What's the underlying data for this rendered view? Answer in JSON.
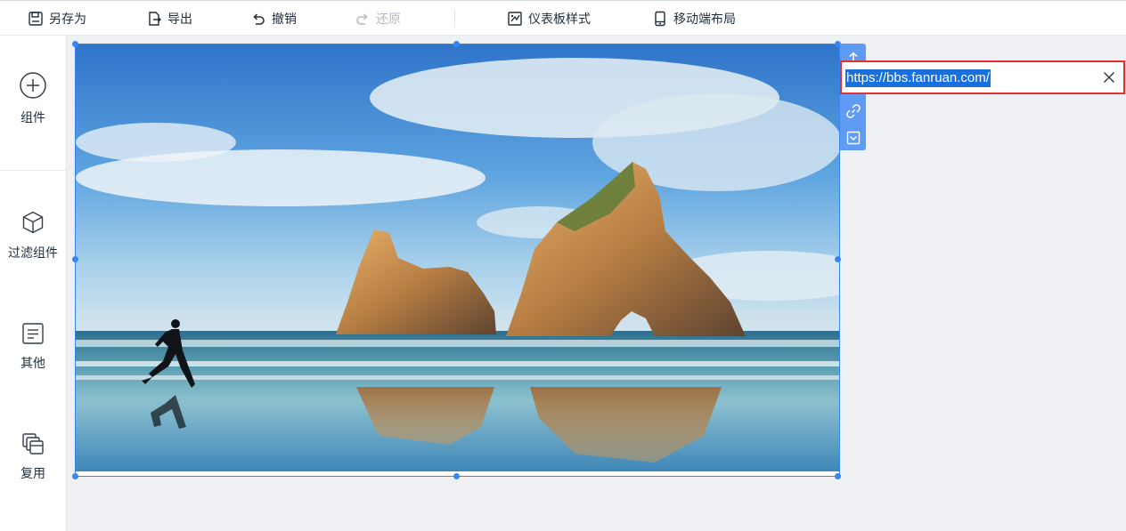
{
  "toolbar": {
    "save_as": "另存为",
    "export": "导出",
    "undo": "撤销",
    "redo": "还原",
    "dashboard_style": "仪表板样式",
    "mobile_layout": "移动端布局"
  },
  "leftpanel": {
    "items": [
      {
        "label": "组件",
        "icon": "plus-circle-icon"
      },
      {
        "label": "过滤组件",
        "icon": "cube-icon"
      },
      {
        "label": "其他",
        "icon": "document-icon"
      },
      {
        "label": "复用",
        "icon": "stack-copy-icon"
      }
    ]
  },
  "widget": {
    "image_description_icon": "landscape-photo",
    "url": "https://bbs.fanruan.com/",
    "url_selected": true
  },
  "side_tools": [
    "upload-icon",
    "link-icon",
    "dropdown-icon"
  ],
  "colors": {
    "accent": "#3685f2",
    "side_toolbar": "#5f9af3",
    "highlight_border": "#e0302f",
    "selection": "#1a6fdf",
    "canvas_bg": "#eff0f4"
  }
}
